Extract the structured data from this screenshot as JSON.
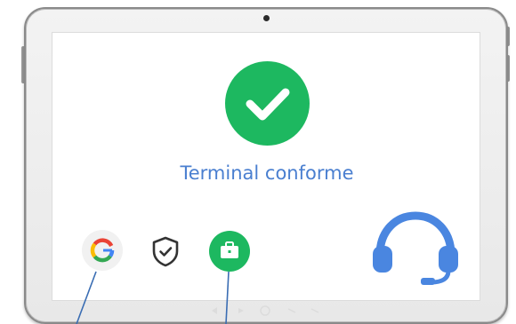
{
  "status": {
    "title": "Terminal conforme",
    "icon": "check-circle-icon",
    "color": "#1db860"
  },
  "title_color": "#4a7fd0",
  "apps": [
    {
      "name": "google-icon"
    },
    {
      "name": "shield-check-icon"
    },
    {
      "name": "work-briefcase-icon",
      "color": "#1db860"
    }
  ],
  "support": {
    "icon": "headset-icon",
    "color": "#4a86e0"
  },
  "callout_color": "#3a6db3"
}
